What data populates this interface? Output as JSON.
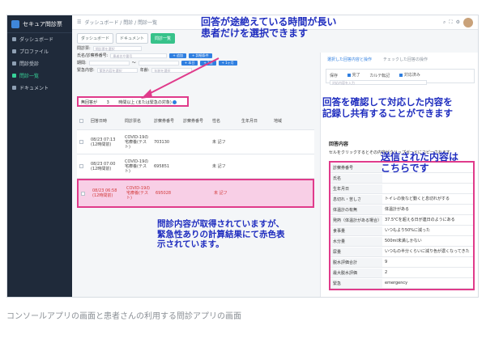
{
  "sidebar": {
    "brand": "セキュア問診票",
    "items": [
      {
        "label": "ダッシュボード",
        "active": false
      },
      {
        "label": "プロファイル",
        "active": false
      },
      {
        "label": "問診受診",
        "active": false
      },
      {
        "label": "問診一覧",
        "active": true
      },
      {
        "label": "ドキュメント",
        "active": false
      }
    ]
  },
  "topbar": {
    "breadcrumb": "ダッシュボード / 問診 / 問診一覧",
    "icons": [
      "search-icon",
      "expand-icon",
      "settings-icon"
    ]
  },
  "chips": [
    "ダッシュボード",
    "ドキュメント",
    "問診一覧"
  ],
  "form": {
    "row1_label": "問診票:",
    "row1_placeholder": "問診票を選択",
    "row2_label": "氏名/診察券番号:",
    "row2_placeholder": "患者名や番号",
    "btn1": "+ 追加",
    "btn2": "+ 詳細条件",
    "row3_label": "期間:",
    "range_sep": "〜",
    "btn3": "+ 本日",
    "btn4": "+ 1週",
    "btn5": "+ 1ヶ月",
    "row4_label": "緊急内容:",
    "row4_placeholder": "緊急内容を選択",
    "row4b_label": "年齢:",
    "row4b_placeholder": "年齢を選択"
  },
  "filter": {
    "label": "無回答が",
    "value": "3",
    "text": "時間以上 (または緊急の対象)"
  },
  "table": {
    "headers": [
      "回答日時",
      "問診票名",
      "診察券番号",
      "診察券番号",
      "性名",
      "生年月日",
      "地域"
    ],
    "rows": [
      {
        "datetime": "08/23 07:13 (12時間前)",
        "form": "COVID-19の 宅療養(テスト)",
        "id": "703130",
        "extra": "",
        "sex": "未 記フ",
        "alert": false
      },
      {
        "datetime": "08/23 07:00 (12時間前)",
        "form": "COVID-19の 宅療養(テスト)",
        "id": "695851",
        "extra": "",
        "sex": "未 記フ",
        "alert": false
      },
      {
        "datetime": "08/23 06:58 (12時間前)",
        "form": "COVID-19の 宅療養(テスト)",
        "id": "695028",
        "extra": "",
        "sex": "未 記フ",
        "alert": true
      }
    ]
  },
  "right": {
    "tab_active": "選択した回答内容と操作",
    "tab_other": "チェックした回答の操作",
    "options": [
      "保存",
      "完了",
      "カルテ転記",
      "対応済み"
    ],
    "note_placeholder": "対応内容を入力",
    "section_title": "回答内容",
    "section_sub": "セルをクリックするとその内容がクリップボードにコピーされます",
    "rows": [
      {
        "k": "診察券番号",
        "v": ""
      },
      {
        "k": "氏名",
        "v": ""
      },
      {
        "k": "生年月日",
        "v": ""
      },
      {
        "k": "息切れ・苦しさ",
        "v": "トイレの後など動くと息切れがする"
      },
      {
        "k": "体温計の有無",
        "v": "体温計がある"
      },
      {
        "k": "発熱（体温計がある場合）",
        "v": "37.5℃を超える日が連日のようにある"
      },
      {
        "k": "食事量",
        "v": "いつもより50%に減った"
      },
      {
        "k": "水分量",
        "v": "500ml未満しかない"
      },
      {
        "k": "尿量",
        "v": "いつもの半分くらいに減り色が濃くなってきた"
      },
      {
        "k": "脱水評価合計",
        "v": "9"
      },
      {
        "k": "最大脱水評価",
        "v": "2"
      },
      {
        "k": "緊急",
        "v": "emergency"
      }
    ]
  },
  "annotations": {
    "a1": "回答が途絶えている時間が長い\n患者だけを選択できます",
    "a2": "回答を確認して対応した内容を\n記録し共有することができます",
    "a3": "送信された内容は\nこちらです",
    "a4": "問診内容が取得されていますが、\n緊急性ありの計算結果にて赤色表\n示されています。"
  },
  "caption": "コンソールアプリの画面と患者さんの利用する問診アプリの画面",
  "colors": {
    "sidebar": "#1f2a3a",
    "accent": "#2f7fe0",
    "alert": "#e03b8b",
    "annotation": "#1f2dbf",
    "active": "#37d399"
  }
}
